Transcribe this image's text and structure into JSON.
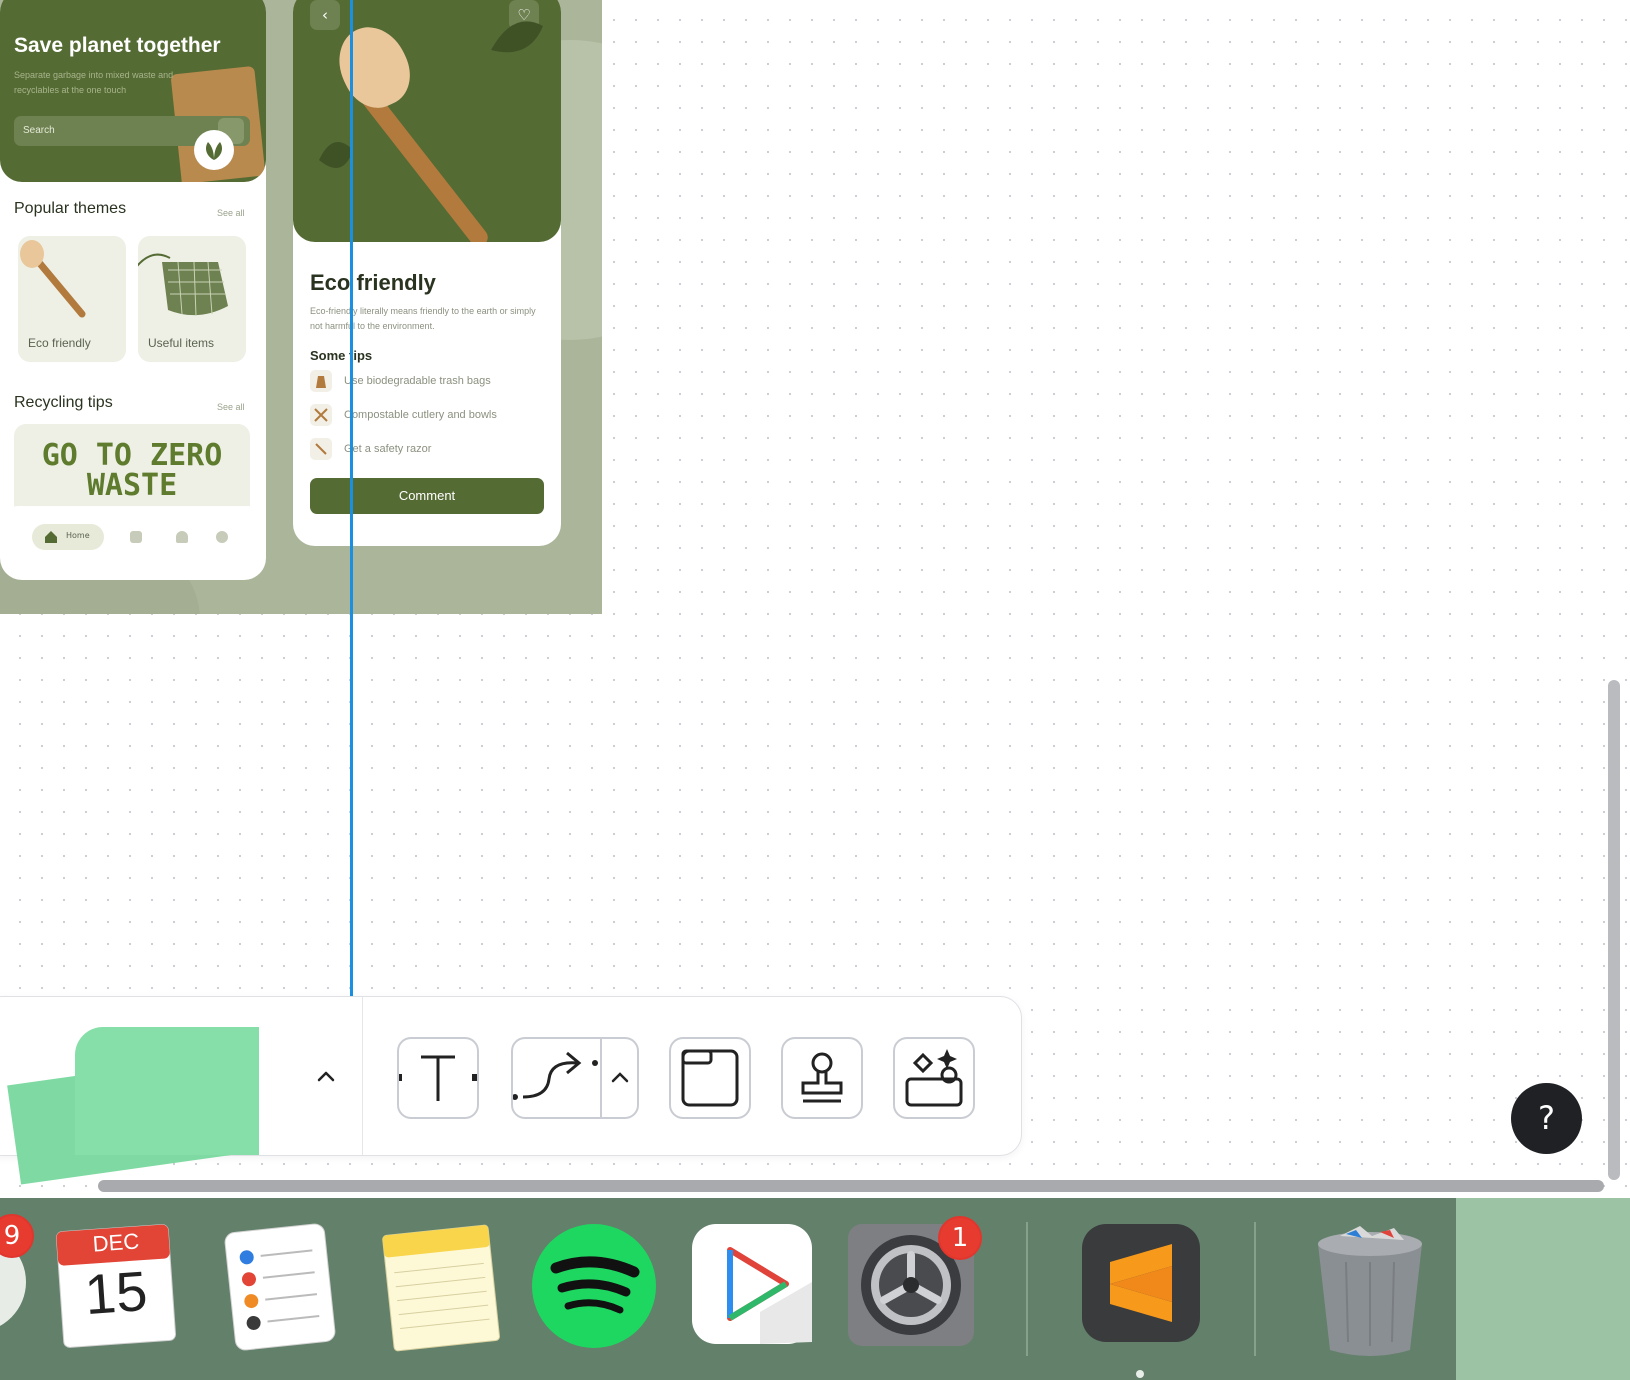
{
  "artboard": {
    "home": {
      "title": "Save planet together",
      "subtitle": "Separate garbage into mixed waste and recyclables at the one touch",
      "search_placeholder": "Search",
      "popular_title": "Popular themes",
      "see_all": "See all",
      "themes": [
        {
          "label": "Eco friendly"
        },
        {
          "label": "Useful items"
        }
      ],
      "recycling_title": "Recycling tips",
      "see_all_2": "See all",
      "banner_line1": "GO TO ZERO",
      "banner_line2": "WASTE",
      "tab_home": "Home"
    },
    "detail": {
      "back": "‹",
      "heart": "♡",
      "title": "Eco friendly",
      "description": "Eco-friendly literally means friendly to the earth or simply not harmful to the environment.",
      "tips_title": "Some tips",
      "tips": [
        {
          "text": "Use biodegradable trash bags"
        },
        {
          "text": "Compostable cutlery and bowls"
        },
        {
          "text": "Get a safety razor"
        }
      ],
      "comment_button": "Comment"
    }
  },
  "toolbar": {
    "tools": [
      {
        "icon": "sticky-note-stack-icon"
      },
      {
        "icon": "chevron-up-icon"
      },
      {
        "icon": "text-tool-icon"
      },
      {
        "icon": "connector-tool-icon"
      },
      {
        "icon": "frame-tool-icon"
      },
      {
        "icon": "stamp-tool-icon"
      },
      {
        "icon": "magic-shapes-icon"
      }
    ]
  },
  "help_button": "?",
  "dock": {
    "apps": [
      {
        "name": "partial-app-icon",
        "badge": "9"
      },
      {
        "name": "calendar-icon",
        "month": "DEC",
        "day": "15"
      },
      {
        "name": "reminders-icon"
      },
      {
        "name": "notes-icon"
      },
      {
        "name": "spotify-icon"
      },
      {
        "name": "infuse-player-icon"
      },
      {
        "name": "system-preferences-icon",
        "badge": "1"
      },
      {
        "name": "sublime-text-icon"
      },
      {
        "name": "trash-icon"
      }
    ]
  },
  "colors": {
    "brand_green": "#556b34",
    "guide_blue": "#1b8fe0",
    "sticky_green": "#86dea8",
    "dock_bg": "#62806a",
    "badge_red": "#e83b30"
  }
}
